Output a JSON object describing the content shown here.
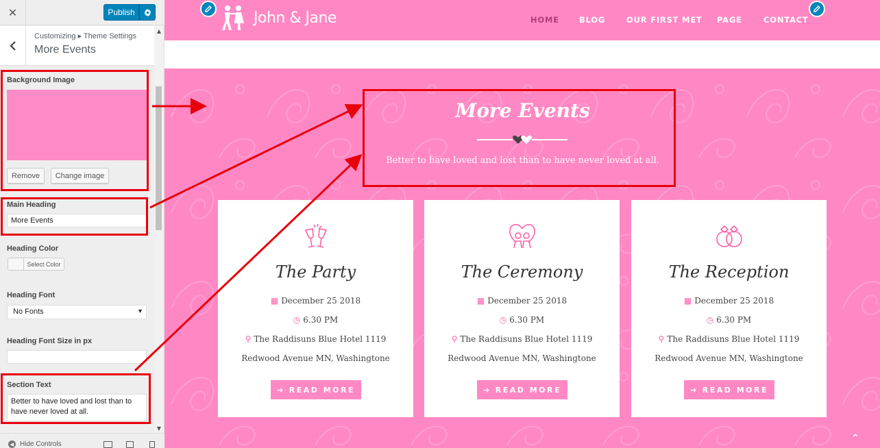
{
  "customizer": {
    "close_label": "✕",
    "publish_label": "Publish",
    "gear_icon": "gear-icon",
    "breadcrumb": "Customizing ▸ Theme Settings",
    "section_title": "More Events",
    "controls": {
      "background_image_label": "Background Image",
      "remove_label": "Remove",
      "change_image_label": "Change image",
      "main_heading_label": "Main Heading",
      "main_heading_value": "More Events",
      "heading_color_label": "Heading Color",
      "select_color_label": "Select Color",
      "heading_font_label": "Heading Font",
      "heading_font_value": "No Fonts",
      "heading_font_size_label": "Heading Font Size in px",
      "heading_font_size_value": "",
      "section_text_label": "Section Text",
      "section_text_value": "Better to have loved and lost than to have never loved at all."
    },
    "hide_controls_label": "Hide Controls",
    "preview_bg_color": "#ff8ac8"
  },
  "site": {
    "logo_text": "John & Jane",
    "nav": [
      "HOME",
      "BLOG",
      "OUR FIRST MET",
      "PAGE",
      "CONTACT"
    ],
    "accent_color": "#ff88c4",
    "section": {
      "heading": "More Events",
      "text": "Better to have loved and lost than to have never loved at all."
    },
    "cards": [
      {
        "icon": "champagne-glasses-icon",
        "title": "The Party",
        "date": "December 25 2018",
        "time": "6.30 PM",
        "place": "The Raddisuns Blue Hotel 1119",
        "address": "Redwood Avenue MN, Washingtone",
        "button": "READ MORE"
      },
      {
        "icon": "couple-heart-icon",
        "title": "The Ceremony",
        "date": "December 25 2018",
        "time": "6.30 PM",
        "place": "The Raddisuns Blue Hotel 1119",
        "address": "Redwood Avenue MN, Washingtone",
        "button": "READ MORE"
      },
      {
        "icon": "wedding-rings-icon",
        "title": "The Reception",
        "date": "December 25 2018",
        "time": "6.30 PM",
        "place": "The Raddisuns Blue Hotel 1119",
        "address": "Redwood Avenue MN, Washingtone",
        "button": "READ MORE"
      }
    ]
  }
}
